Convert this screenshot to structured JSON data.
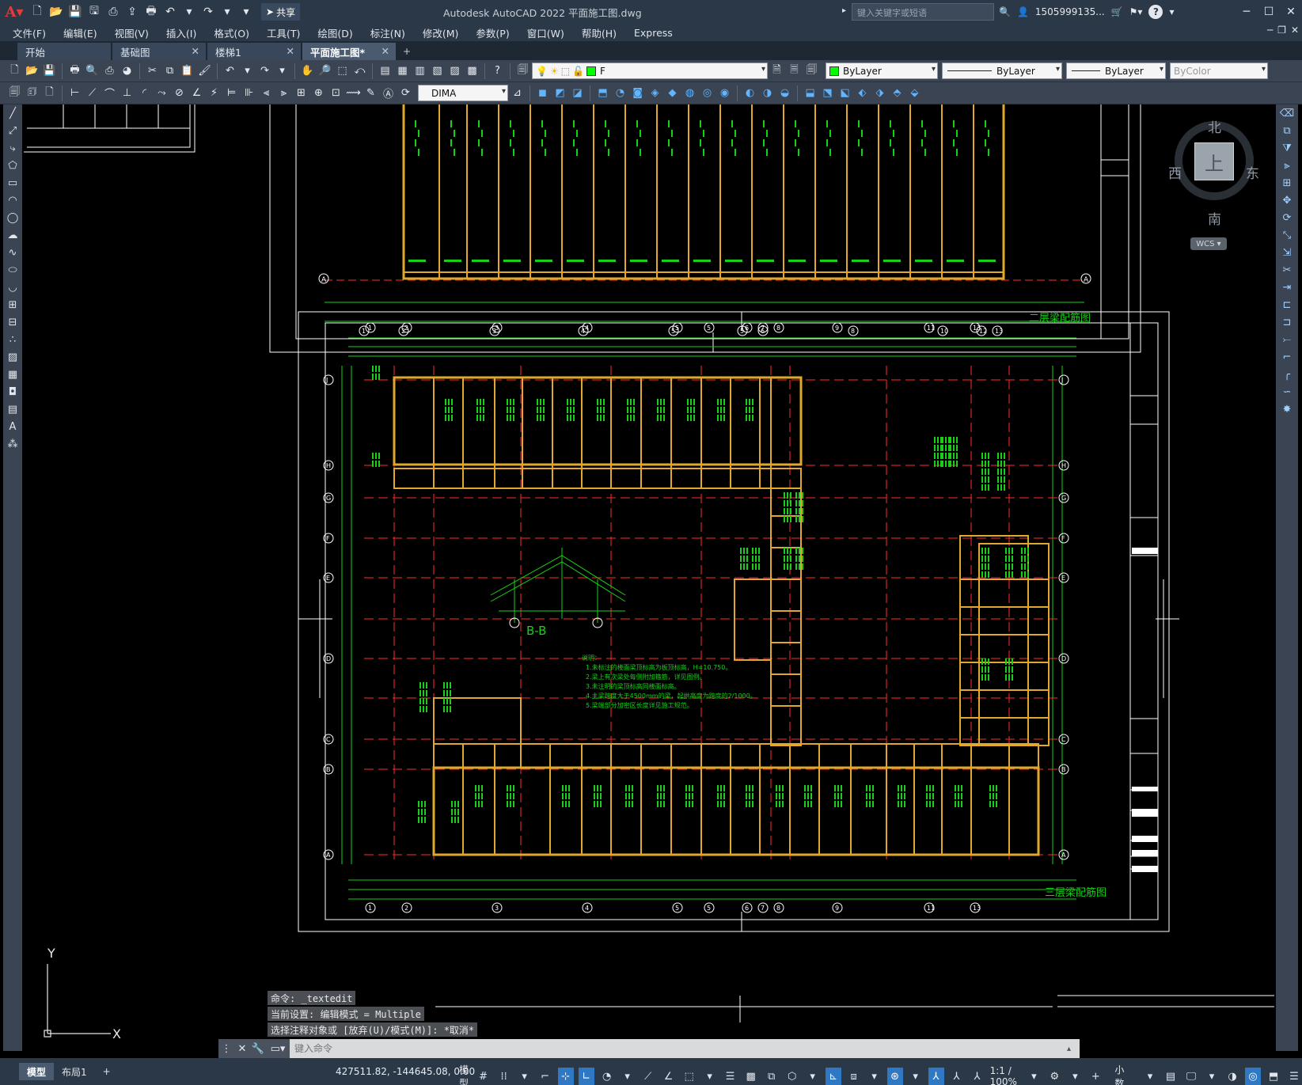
{
  "app": {
    "title": "Autodesk AutoCAD 2022    平面施工图.dwg",
    "share_label": "共享",
    "search_placeholder": "键入关键字或短语",
    "user": "1505999135...",
    "help": "?"
  },
  "menu": [
    "文件(F)",
    "编辑(E)",
    "视图(V)",
    "插入(I)",
    "格式(O)",
    "工具(T)",
    "绘图(D)",
    "标注(N)",
    "修改(M)",
    "参数(P)",
    "窗口(W)",
    "帮助(H)",
    "Express"
  ],
  "tabs": [
    {
      "label": "开始",
      "active": false,
      "closable": false
    },
    {
      "label": "基础图",
      "active": false,
      "closable": true
    },
    {
      "label": "楼梯1",
      "active": false,
      "closable": true
    },
    {
      "label": "平面施工图*",
      "active": true,
      "closable": true
    }
  ],
  "properties": {
    "layer": "F",
    "color": "ByLayer",
    "linetype": "ByLayer",
    "lineweight": "ByLayer",
    "plotstyle": "ByColor",
    "dimstyle": "DIMA"
  },
  "viewcube": {
    "north": "北",
    "south": "南",
    "east": "东",
    "west": "西",
    "top": "上",
    "wcs": "WCS"
  },
  "drawing": {
    "title_upper": "二层梁配筋图",
    "title_lower": "三层梁配筋图",
    "section_label": "B-B",
    "upper_axes": [
      "1",
      "2",
      "3",
      "4",
      "5",
      "5",
      "6",
      "8",
      "10",
      "12",
      "13"
    ],
    "lower_axes": [
      "1",
      "2",
      "3",
      "4",
      "5",
      "5",
      "6",
      "7",
      "8",
      "9",
      "11",
      "13"
    ],
    "left_axes": [
      "J",
      "H",
      "G",
      "F",
      "E",
      "D",
      "C",
      "B",
      "A"
    ],
    "right_axes": [
      "J",
      "H",
      "G",
      "F",
      "E",
      "D",
      "C",
      "B",
      "A"
    ],
    "notes_title": "说明：",
    "notes": [
      "1.未标注的楼面梁顶标高为板顶标高，H=10.750。",
      "2.梁上有次梁处每侧附加箍筋，详见图例。",
      "3.未注明的梁顶标高同楼面标高。",
      "4.主梁跨度大于4500mm的梁，起拱高度为跨度的2/1000。",
      "5.梁端部分加密区长度详见施工规范。"
    ]
  },
  "command": {
    "history": [
      "命令: _textedit",
      "当前设置: 编辑模式 = Multiple",
      "选择注释对象或 [放弃(U)/模式(M)]: *取消*"
    ],
    "placeholder": "键入命令"
  },
  "status": {
    "layout_tabs": [
      "模型",
      "布局1"
    ],
    "coords": "427511.82, -144645.08, 0.00",
    "model": "模型",
    "scale": "1:1 / 100%",
    "units": "小数"
  },
  "ucs": {
    "x": "X",
    "y": "Y"
  }
}
